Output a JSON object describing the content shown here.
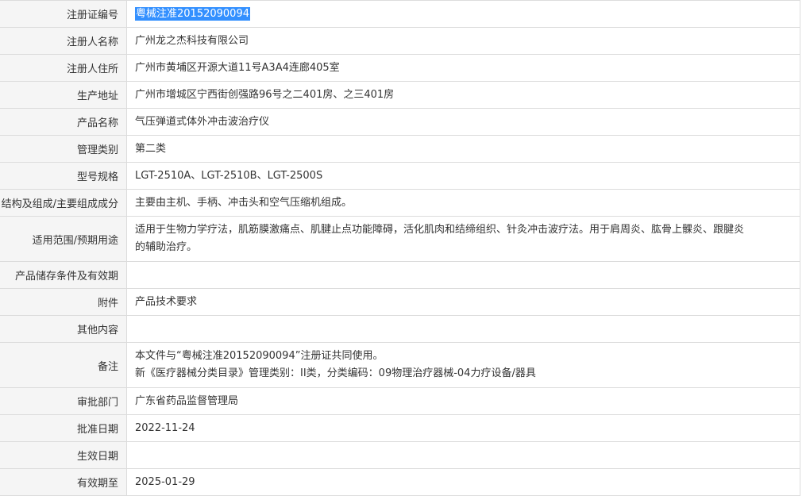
{
  "rows": [
    {
      "label": "注册证编号",
      "value": "粤械注准20152090094"
    },
    {
      "label": "注册人名称",
      "value": "广州龙之杰科技有限公司"
    },
    {
      "label": "注册人住所",
      "value": "广州市黄埔区开源大道11号A3A4连廊405室"
    },
    {
      "label": "生产地址",
      "value": "广州市增城区宁西街创强路96号之二401房、之三401房"
    },
    {
      "label": "产品名称",
      "value": "气压弹道式体外冲击波治疗仪"
    },
    {
      "label": "管理类别",
      "value": "第二类"
    },
    {
      "label": "型号规格",
      "value": "LGT-2510A、LGT-2510B、LGT-2500S"
    },
    {
      "label": "结构及组成/主要组成成分",
      "value": "主要由主机、手柄、冲击头和空气压缩机组成。"
    },
    {
      "label": "适用范围/预期用途",
      "value_line1": "适用于生物力学疗法，肌筋膜激痛点、肌腱止点功能障碍，活化肌肉和结缔组织、针灸冲击波疗法。用于肩周炎、肱骨上髁炎、跟腱炎",
      "value_line2": "的辅助治疗。"
    },
    {
      "label": "产品储存条件及有效期",
      "value": ""
    },
    {
      "label": "附件",
      "value": "产品技术要求"
    },
    {
      "label": "其他内容",
      "value": ""
    },
    {
      "label": "备注",
      "value_line1": "本文件与“粤械注准20152090094”注册证共同使用。",
      "value_line2": "新《医疗器械分类目录》管理类别：II类，分类编码：09物理治疗器械-04力疗设备/器具"
    },
    {
      "label": "审批部门",
      "value": "广东省药品监督管理局"
    },
    {
      "label": "批准日期",
      "value": "2022-11-24"
    },
    {
      "label": "生效日期",
      "value": ""
    },
    {
      "label": "有效期至",
      "value": "2025-01-29"
    }
  ],
  "colors": {
    "label_bg": "#f5f5f5",
    "border": "#dcdcdc",
    "selection": "#3390ff"
  }
}
